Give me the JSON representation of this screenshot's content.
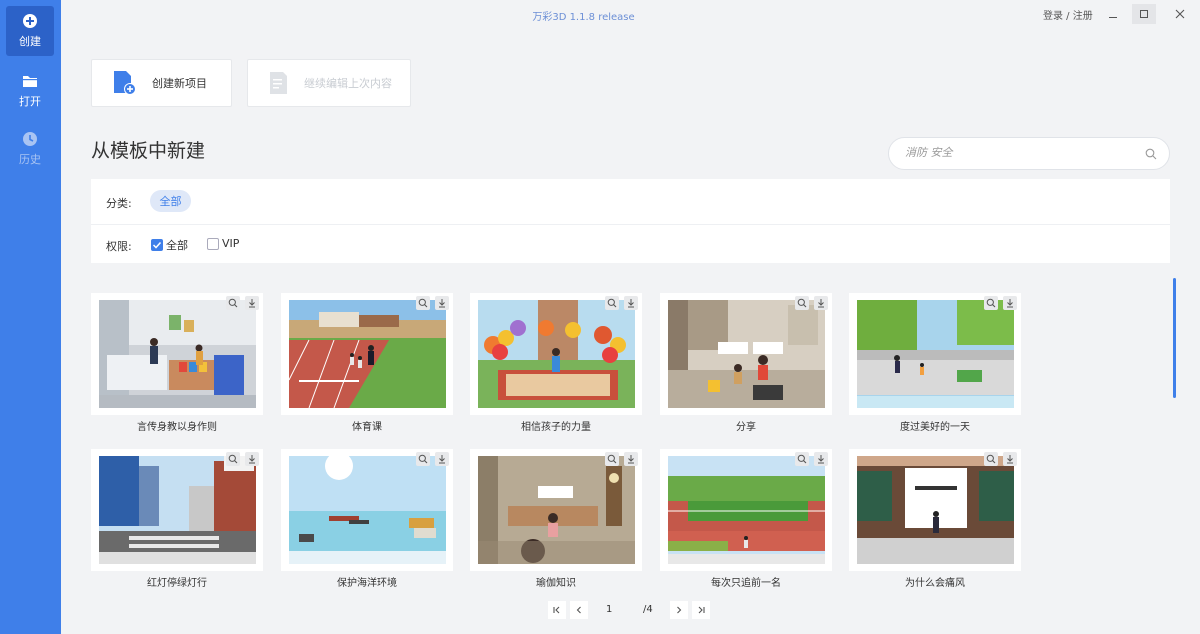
{
  "app": {
    "title": "万彩3D 1.1.8 release",
    "login": "登录 / 注册"
  },
  "sidebar": {
    "items": [
      {
        "label": "创建",
        "icon": "plus-circle-icon"
      },
      {
        "label": "打开",
        "icon": "folder-icon"
      },
      {
        "label": "历史",
        "icon": "clock-icon"
      }
    ]
  },
  "actions": {
    "create_new": "创建新项目",
    "continue_edit": "继续编辑上次内容"
  },
  "section": {
    "title": "从模板中新建"
  },
  "search": {
    "placeholder": "消防 安全"
  },
  "filters": {
    "category_label": "分类:",
    "category_value": "全部",
    "permission_label": "权限:",
    "perm_all": "全部",
    "perm_vip": "VIP",
    "perm_all_checked": true,
    "perm_vip_checked": false
  },
  "templates": [
    {
      "title": "言传身教以身作则",
      "scene": "store"
    },
    {
      "title": "体育课",
      "scene": "track"
    },
    {
      "title": "相信孩子的力量",
      "scene": "balloons"
    },
    {
      "title": "分享",
      "scene": "room"
    },
    {
      "title": "度过美好的一天",
      "scene": "park"
    },
    {
      "title": "红灯停绿灯行",
      "scene": "street"
    },
    {
      "title": "保护海洋环境",
      "scene": "ocean"
    },
    {
      "title": "瑜伽知识",
      "scene": "yoga"
    },
    {
      "title": "每次只追前一名",
      "scene": "field"
    },
    {
      "title": "为什么会痛风",
      "scene": "classroom"
    }
  ],
  "pagination": {
    "current": "1",
    "total": "/4"
  },
  "colors": {
    "accent": "#3f7fe9",
    "sidebar_active": "#2c62c8"
  }
}
